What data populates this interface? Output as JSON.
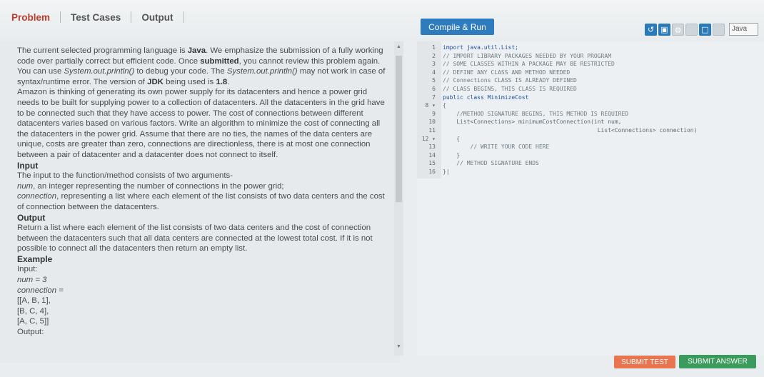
{
  "tabs": [
    {
      "label": "Problem"
    },
    {
      "label": "Test Cases"
    },
    {
      "label": "Output"
    }
  ],
  "toolbar": {
    "compile_label": "Compile & Run",
    "language": "Java",
    "icons": [
      "reset-icon",
      "save-icon",
      "settings-icon",
      "layout-icon",
      "maximize-icon",
      "panel-icon"
    ]
  },
  "problem": {
    "intro_1": "The current selected programming language is ",
    "lang": "Java",
    "intro_2": ". We emphasize the submission of a fully working code over partially correct but efficient code. Once ",
    "submitted": "submitted",
    "intro_3": ", you cannot review this problem again. You can use ",
    "println_1": "System.out.println()",
    "intro_4": " to debug your code. The ",
    "println_2": "System.out.println()",
    "intro_5": " may not work in case of syntax/runtime error. The version of ",
    "jdk": "JDK",
    "intro_6": " being used is ",
    "jdk_version": "1.8",
    "intro_7": ".",
    "statement": "Amazon is thinking of generating its own power supply for its datacenters and hence a power grid needs to be built for supplying power to a collection of datacenters. All the datacenters in the grid have to be connected such that they have access to power. The cost of connections between different datacenters varies based on various factors. Write an algorithm to minimize the cost of connecting all the datacenters in the power grid. Assume that there are no ties, the names of the data centers are unique, costs are greater than zero, connections are directionless, there is at most one connection between a pair of datacenter and a datacenter does not connect to itself.",
    "input_heading": "Input",
    "input_desc": "The input to the function/method consists of two arguments-",
    "arg1_name": "num",
    "arg1_desc": ", an integer representing the number of connections in the power grid;",
    "arg2_name": "connection",
    "arg2_desc": ", representing a list where each element of the list consists of two data centers and the cost of connection between the datacenters.",
    "output_heading": "Output",
    "output_desc": "Return a list where each element of the list consists of two data centers and the cost of connection between the datacenters such that all data centers are connected at the lowest total cost. If it is not possible to connect all the datacenters then return an empty list.",
    "example_heading": "Example",
    "ex_input_label": "Input:",
    "ex_num": "num = 3",
    "ex_connection": "connection =",
    "ex_row1": "[[A, B, 1],",
    "ex_row2": "[B, C, 4],",
    "ex_row3": "[A, C, 5]]",
    "ex_output_label": "Output:"
  },
  "code": {
    "lines": [
      {
        "n": "1",
        "text": "import java.util.List;"
      },
      {
        "n": "2",
        "text": "// IMPORT LIBRARY PACKAGES NEEDED BY YOUR PROGRAM"
      },
      {
        "n": "3",
        "text": "// SOME CLASSES WITHIN A PACKAGE MAY BE RESTRICTED"
      },
      {
        "n": "4",
        "text": "// DEFINE ANY CLASS AND METHOD NEEDED"
      },
      {
        "n": "5",
        "text": "// Connections CLASS IS ALREADY DEFINED"
      },
      {
        "n": "6",
        "text": "// CLASS BEGINS, THIS CLASS IS REQUIRED"
      },
      {
        "n": "7",
        "text": "public class MinimizeCost"
      },
      {
        "n": "8 ▾",
        "text": "{"
      },
      {
        "n": "9",
        "text": "    //METHOD SIGNATURE BEGINS, THIS METHOD IS REQUIRED"
      },
      {
        "n": "10",
        "text": "    List<Connections> minimumCostConnection(int num,"
      },
      {
        "n": "11",
        "text": "                                             List<Connections> connection)"
      },
      {
        "n": "12 ▾",
        "text": "    {"
      },
      {
        "n": "13",
        "text": "        // WRITE YOUR CODE HERE"
      },
      {
        "n": "14",
        "text": "    }"
      },
      {
        "n": "15",
        "text": "    // METHOD SIGNATURE ENDS"
      },
      {
        "n": "16",
        "text": "}|"
      }
    ]
  },
  "buttons": {
    "submit_test": "SUBMIT TEST",
    "submit_answer": "SUBMIT ANSWER"
  },
  "colors": {
    "accent_blue": "#2e7bbd",
    "active_tab": "#c0392b",
    "submit_test": "#e8754f",
    "submit_answer": "#3a9b5c"
  }
}
